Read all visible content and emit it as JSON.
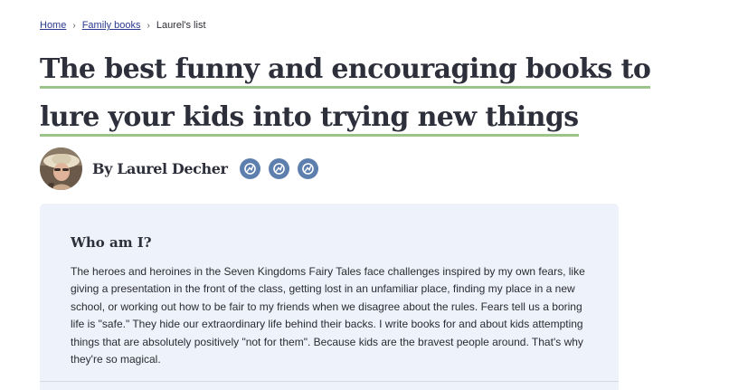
{
  "breadcrumb": {
    "home": "Home",
    "section": "Family books",
    "current": "Laurel's list"
  },
  "title": {
    "line1": "The best funny and encouraging books to",
    "line2": "lure your kids into trying new things"
  },
  "author": {
    "byline": "By Laurel Decher",
    "social_icons": [
      "social-link-icon",
      "social-link-icon",
      "social-link-icon"
    ]
  },
  "about": {
    "heading": "Who am I?",
    "body": "The heroes and heroines in the Seven Kingdoms Fairy Tales face challenges inspired by my own fears, like giving a presentation in the front of the class, getting lost in an unfamiliar place, finding my place in a new school, or working out how to be fair to my friends when we disagree about the rules. Fears tell us a boring life is \"safe.\" They hide our extraordinary life behind their backs. I write books for and about kids attempting things that are absolutely positively \"not for them\". Because kids are the bravest people around. That's why they're so magical."
  },
  "colors": {
    "title_underline": "#9bc48a",
    "social_button": "#5d7fae",
    "card_background": "#eef2fb",
    "link": "#2a3b8f"
  }
}
